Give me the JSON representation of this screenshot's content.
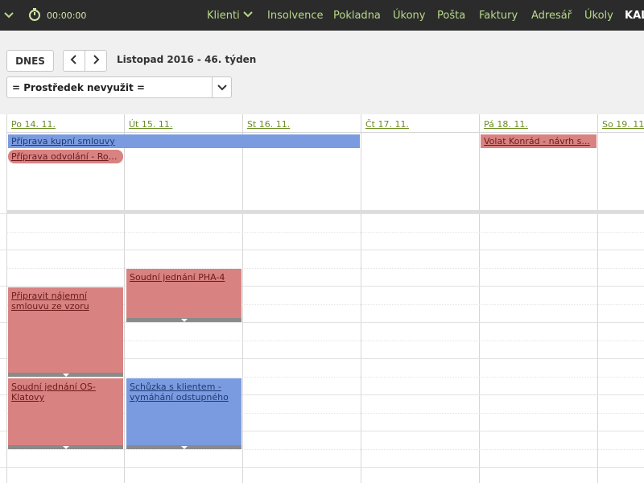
{
  "topbar": {
    "timer": "00:00:00",
    "nav": [
      {
        "label": "Klienti",
        "has_caret": true
      },
      {
        "label": "Insolvence"
      },
      {
        "label": "Pokladna"
      },
      {
        "label": "Úkony"
      },
      {
        "label": "Pošta"
      },
      {
        "label": "Faktury"
      },
      {
        "label": "Adresář"
      },
      {
        "label": "Úkoly"
      },
      {
        "label": "KAL",
        "active": true
      }
    ]
  },
  "toolbar": {
    "today_label": "DNES",
    "period": "Listopad 2016 - 46. týden",
    "filter_value": "= Prostředek nevyužit ="
  },
  "calendar": {
    "days": [
      "Po 14. 11.",
      "Út 15. 11.",
      "St 16. 11.",
      "Čt 17. 11.",
      "Pá 18. 11.",
      "So 19. 11."
    ],
    "allday_events": [
      {
        "title": "Příprava kupní smlouvy",
        "color": "blue"
      },
      {
        "title": "Příprava odvolání - Rou...",
        "color": "red"
      },
      {
        "title": "Volat Konrád - návrh s...",
        "color": "red"
      }
    ],
    "timed_events": [
      {
        "title": "Soudní jednání PHA-4",
        "color": "red"
      },
      {
        "title": "Připravit nájemní smlouvu ze vzoru",
        "color": "red"
      },
      {
        "title": "Soudní jednání OS-Klatovy",
        "color": "red"
      },
      {
        "title": "Schůzka s klientem - vymáhání odstupného",
        "color": "blue"
      }
    ]
  },
  "colors": {
    "topbar_bg": "#2b2b2b",
    "nav_text": "#b9d98a",
    "event_blue": "#7a9be0",
    "event_red": "#d98282"
  }
}
